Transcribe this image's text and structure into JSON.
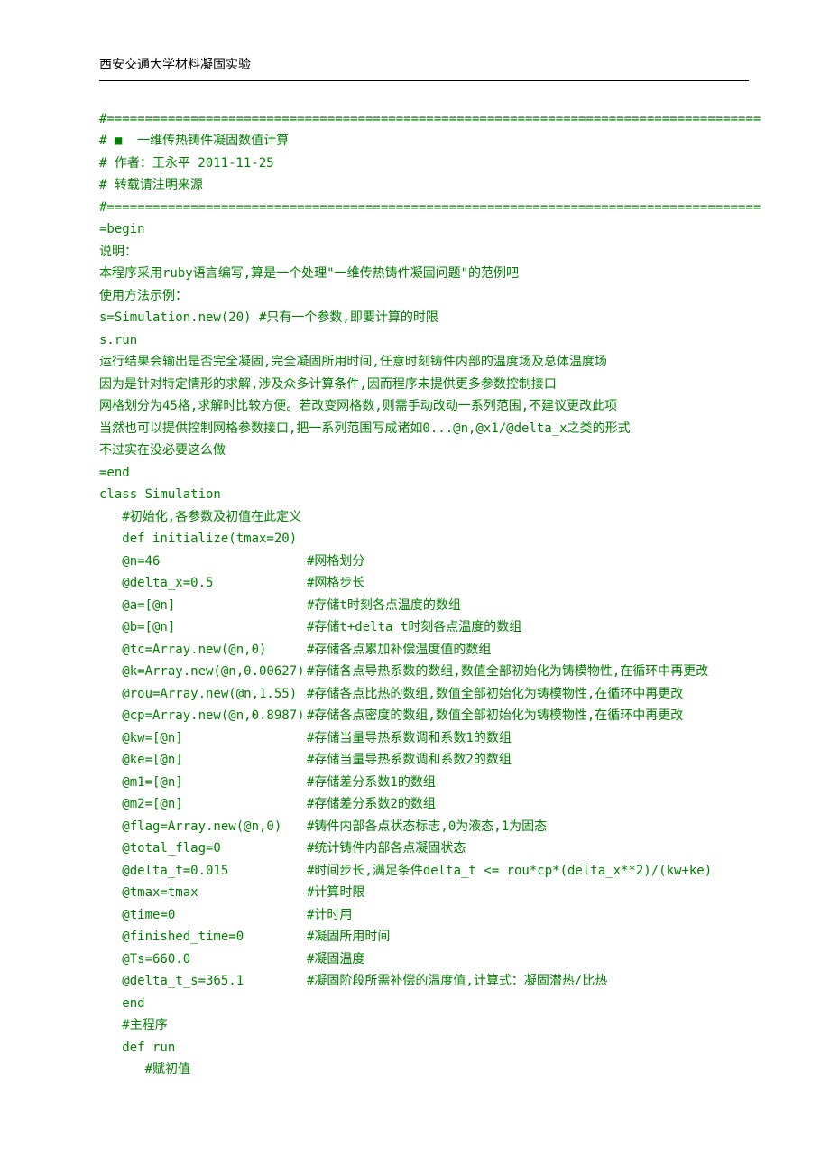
{
  "header": "西安交通大学材料凝固实验",
  "lines": [
    "#======================================================================================",
    "# ■  一维传热铸件凝固数值计算",
    "# 作者：王永平 2011-11-25",
    "# 转载请注明来源",
    "#======================================================================================",
    "=begin",
    "说明：",
    "本程序采用ruby语言编写,算是一个处理\"一维传热铸件凝固问题\"的范例吧",
    "使用方法示例：",
    "s=Simulation.new(20) #只有一个参数,即要计算的时限",
    "s.run",
    "运行结果会输出是否完全凝固,完全凝固所用时间,任意时刻铸件内部的温度场及总体温度场",
    "因为是针对特定情形的求解,涉及众多计算条件,因而程序未提供更多参数控制接口",
    "网格划分为45格,求解时比较方便。若改变网格数,则需手动改动一系列范围,不建议更改此项",
    "当然也可以提供控制网格参数接口,把一系列范围写成诸如0...@n,@x1/@delta_x之类的形式",
    "不过实在没必要这么做",
    "=end",
    "class Simulation",
    "   #初始化,各参数及初值在此定义",
    "   def initialize(tmax=20)"
  ],
  "defs": [
    {
      "var": "   @n=46",
      "cmt": "#网格划分"
    },
    {
      "var": "   @delta_x=0.5",
      "cmt": "#网格步长"
    },
    {
      "var": "   @a=[@n]",
      "cmt": "#存储t时刻各点温度的数组"
    },
    {
      "var": "   @b=[@n]",
      "cmt": "#存储t+delta_t时刻各点温度的数组"
    },
    {
      "var": "   @tc=Array.new(@n,0)",
      "cmt": "#存储各点累加补偿温度值的数组"
    },
    {
      "var": "   @k=Array.new(@n,0.00627)",
      "cmt": "#存储各点导热系数的数组,数值全部初始化为铸模物性,在循环中再更改"
    },
    {
      "var": "   @rou=Array.new(@n,1.55)",
      "cmt": "#存储各点比热的数组,数值全部初始化为铸模物性,在循环中再更改"
    },
    {
      "var": "   @cp=Array.new(@n,0.8987)",
      "cmt": "#存储各点密度的数组,数值全部初始化为铸模物性,在循环中再更改"
    },
    {
      "var": "   @kw=[@n]",
      "cmt": "#存储当量导热系数调和系数1的数组"
    },
    {
      "var": "   @ke=[@n]",
      "cmt": "#存储当量导热系数调和系数2的数组"
    },
    {
      "var": "   @m1=[@n]",
      "cmt": "#存储差分系数1的数组"
    },
    {
      "var": "   @m2=[@n]",
      "cmt": "#存储差分系数2的数组"
    },
    {
      "var": "   @flag=Array.new(@n,0)",
      "cmt": "#铸件内部各点状态标志,0为液态,1为固态"
    },
    {
      "var": "   @total_flag=0",
      "cmt": "#统计铸件内部各点凝固状态"
    },
    {
      "var": "   @delta_t=0.015",
      "cmt": "#时间步长,满足条件delta_t <= rou*cp*(delta_x**2)/(kw+ke)"
    },
    {
      "var": "   @tmax=tmax",
      "cmt": "#计算时限"
    },
    {
      "var": "   @time=0",
      "cmt": "#计时用"
    },
    {
      "var": "   @finished_time=0",
      "cmt": "#凝固所用时间"
    },
    {
      "var": "   @Ts=660.0",
      "cmt": "#凝固温度"
    },
    {
      "var": "   @delta_t_s=365.1",
      "cmt": "#凝固阶段所需补偿的温度值,计算式：凝固潜热/比热"
    }
  ],
  "trailing": [
    "   end",
    "   #主程序",
    "   def run",
    "      #赋初值"
  ]
}
